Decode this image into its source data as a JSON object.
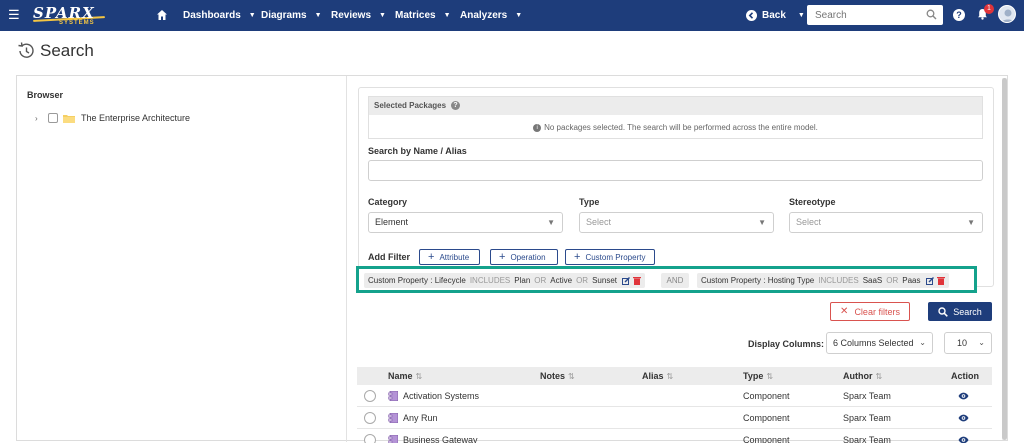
{
  "topbar": {
    "logo": "SPARX",
    "logo_sub": "SYSTEMS",
    "nav": [
      {
        "label": "Dashboards"
      },
      {
        "label": "Diagrams"
      },
      {
        "label": "Reviews"
      },
      {
        "label": "Matrices"
      },
      {
        "label": "Analyzers"
      }
    ],
    "back_label": "Back",
    "search_placeholder": "Search",
    "notification_count": "1",
    "brand_color": "#1e3d7b"
  },
  "page": {
    "title": "Search"
  },
  "browser": {
    "title": "Browser",
    "tree": [
      {
        "label": "The Enterprise Architecture",
        "icon": "folder-icon"
      }
    ]
  },
  "search_panel": {
    "selected_packages_title": "Selected Packages",
    "selected_packages_note": "No packages selected. The search will be performed across the entire model.",
    "name_alias_label": "Search by Name / Alias",
    "name_alias_value": "",
    "category_label": "Category",
    "category_value": "Element",
    "type_label": "Type",
    "type_placeholder": "Select",
    "stereotype_label": "Stereotype",
    "stereotype_placeholder": "Select",
    "add_filter_label": "Add Filter",
    "filter_buttons": [
      {
        "label": "Attribute"
      },
      {
        "label": "Operation"
      },
      {
        "label": "Custom Property"
      }
    ]
  },
  "filters": {
    "highlight_color": "#14a28c",
    "chips": [
      {
        "prefix": "Custom Property : Lifecycle",
        "op": "INCLUDES",
        "v1": "Plan",
        "or1": "OR",
        "v2": "Active",
        "or2": "OR",
        "v3": "Sunset"
      },
      {
        "prefix": "Custom Property : Hosting Type",
        "op": "INCLUDES",
        "v1": "SaaS",
        "or1": "OR",
        "v2": "Paas"
      }
    ],
    "join": "AND"
  },
  "actions": {
    "clear_label": "Clear filters",
    "search_label": "Search",
    "clear_color": "#d9534f"
  },
  "display": {
    "columns_label": "Display Columns:",
    "columns_value": "6 Columns Selected",
    "page_size": "10"
  },
  "results": {
    "columns": [
      "Name",
      "Notes",
      "Alias",
      "Type",
      "Author",
      "Action"
    ],
    "rows": [
      {
        "name": "Activation Systems",
        "notes": "",
        "alias": "",
        "type": "Component",
        "author": "Sparx Team"
      },
      {
        "name": "Any Run",
        "notes": "",
        "alias": "",
        "type": "Component",
        "author": "Sparx Team"
      },
      {
        "name": "Business Gateway",
        "notes": "",
        "alias": "",
        "type": "Component",
        "author": "Sparx Team"
      }
    ]
  }
}
